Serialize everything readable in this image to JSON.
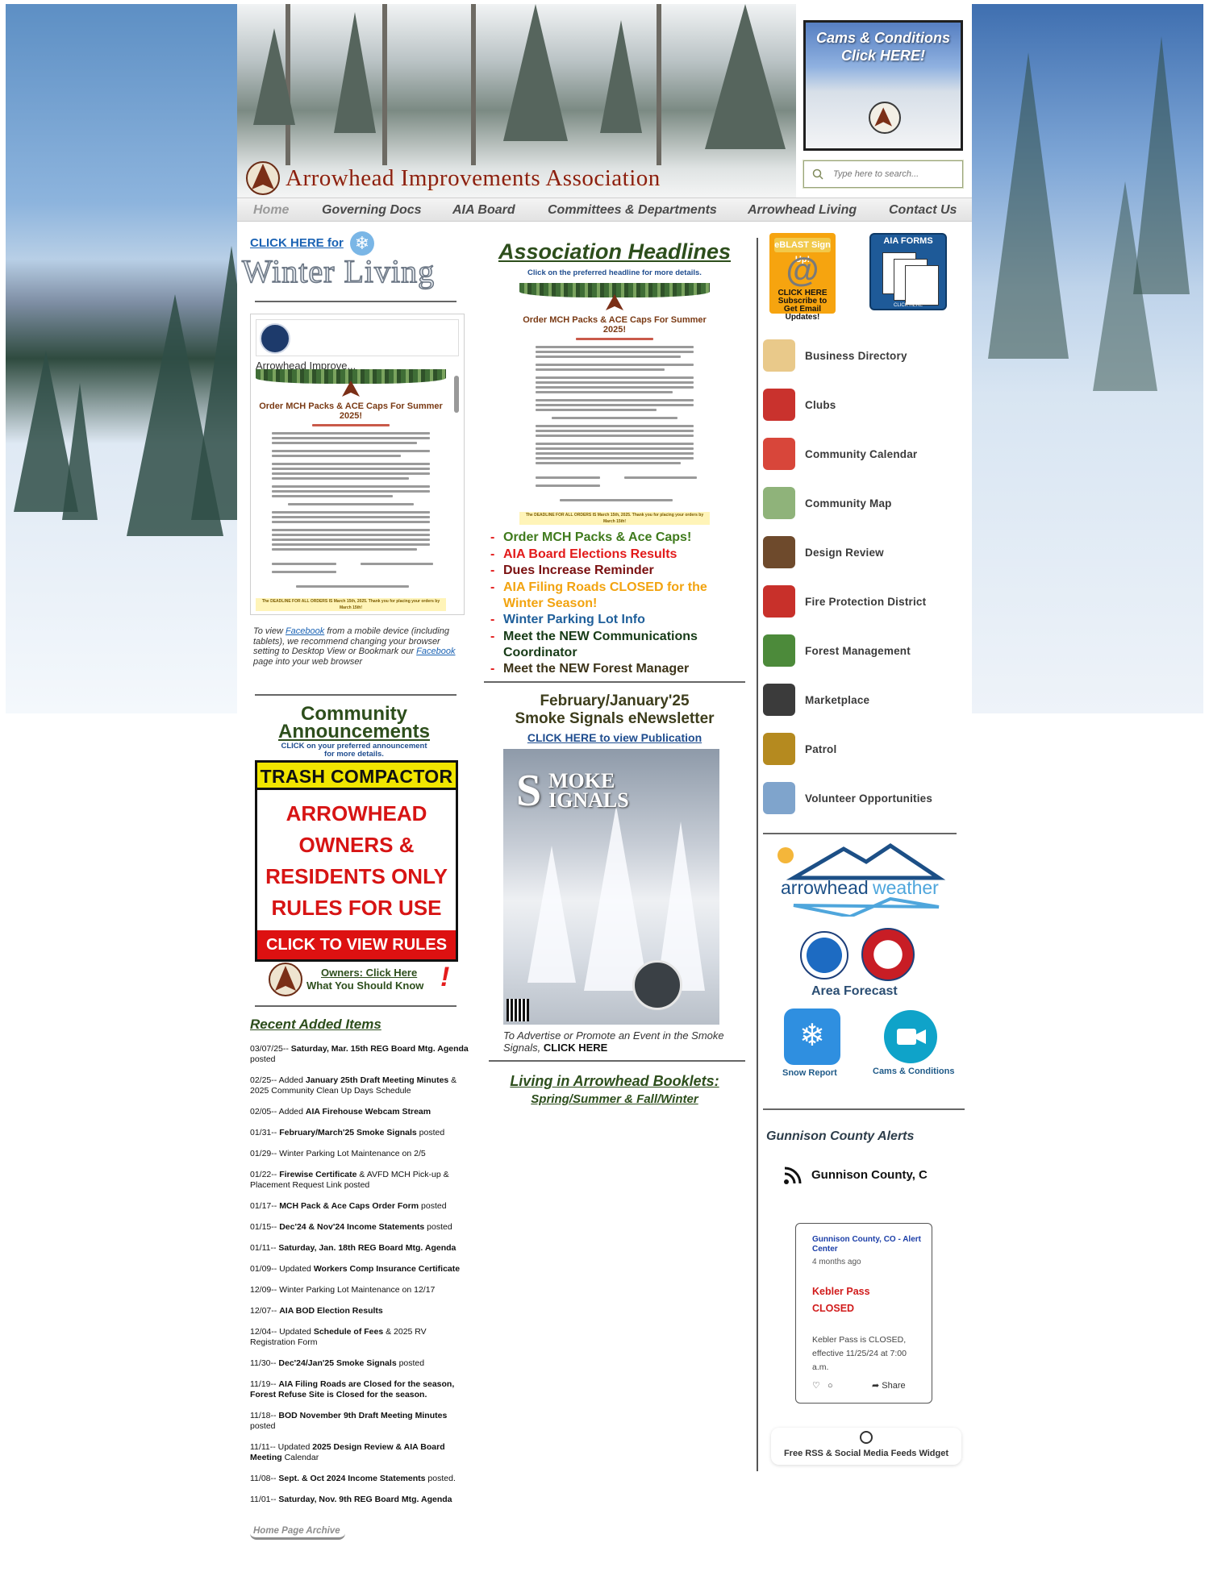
{
  "header": {
    "site_title": "Arrowhead Improvements Association",
    "cams_title": "Cams & Conditions Click HERE!",
    "search_placeholder": "Type here to search..."
  },
  "nav": {
    "items": [
      "Home",
      "Governing Docs",
      "AIA Board",
      "Committees & Departments",
      "Arrowhead Living",
      "Contact Us"
    ]
  },
  "left": {
    "click_here_for": "CLICK HERE for",
    "winter_living": "Winter Living",
    "fb_page_name": "Arrowhead Improve...",
    "flyer_title": "Order MCH Packs & ACE Caps For Summer 2025!",
    "flyer_footer": "The DEADLINE FOR ALL ORDERS IS March 15th, 2025. Thank you for placing your orders by March 15th!",
    "fb_note_1": "To view ",
    "fb_note_link_1": "Facebook",
    "fb_note_2": " from a mobile device (including tablets), we recommend changing your browser setting to Desktop View or Bookmark our ",
    "fb_note_link_2": "Facebook",
    "fb_note_3": " page into your web browser",
    "community_title_1": "Community",
    "community_title_2": "Announcements",
    "community_sub_1": "CLICK on your preferred announcement",
    "community_sub_2": "for more details.",
    "trash_top": "TRASH COMPACTOR",
    "trash_lines": [
      "ARROWHEAD",
      "OWNERS &",
      "RESIDENTS ONLY",
      "RULES FOR USE"
    ],
    "trash_bottom": "CLICK TO VIEW RULES",
    "owners_link": "Owners: Click Here",
    "owners_sub": "What You Should Know",
    "recent_title": "Recent Added Items",
    "recent_items": [
      {
        "pre": "03/07/25-- ",
        "bold": "Saturday, Mar. 15th REG Board Mtg. Agenda",
        "post": " posted"
      },
      {
        "pre": "02/25--  Added ",
        "bold": "January 25th Draft Meeting Minutes",
        "post": " & 2025 Community Clean Up Days Schedule"
      },
      {
        "pre": "02/05-- Added ",
        "bold": "AIA Firehouse Webcam Stream",
        "post": ""
      },
      {
        "pre": "01/31-- ",
        "bold": "February/March'25 Smoke Signals",
        "post": " posted"
      },
      {
        "pre": "01/29-- Winter Parking Lot Maintenance on 2/5",
        "bold": "",
        "post": ""
      },
      {
        "pre": "01/22-- ",
        "bold": "Firewise Certificate",
        "post": " & AVFD MCH Pick-up & Placement Request Link posted"
      },
      {
        "pre": "01/17-- ",
        "bold": "MCH Pack & Ace Caps Order Form",
        "post": " posted"
      },
      {
        "pre": "01/15-- ",
        "bold": "Dec'24 & Nov'24 Income Statements",
        "post": " posted"
      },
      {
        "pre": "01/11-- ",
        "bold": "Saturday, Jan. 18th REG Board Mtg. Agenda",
        "post": ""
      },
      {
        "pre": "01/09-- Updated ",
        "bold": "Workers Comp Insurance Certificate",
        "post": ""
      },
      {
        "pre": "12/09--  Winter Parking Lot Maintenance on 12/17",
        "bold": "",
        "post": ""
      },
      {
        "pre": "12/07-- ",
        "bold": "AIA BOD Election Results",
        "post": ""
      },
      {
        "pre": "12/04-- Updated ",
        "bold": "Schedule of Fees",
        "post": " & 2025 RV Registration Form"
      },
      {
        "pre": "11/30--  ",
        "bold": "Dec'24/Jan'25 Smoke Signals",
        "post": " posted"
      },
      {
        "pre": "11/19-- ",
        "bold": "AIA Filing Roads are Closed for the season, Forest Refuse Site is Closed for the season.",
        "post": ""
      },
      {
        "pre": "11/18-- ",
        "bold": "BOD November 9th Draft Meeting Minutes",
        "post": " posted"
      },
      {
        "pre": "11/11-- Updated ",
        "bold": "2025 Design Review & AIA Board Meeting",
        "post": " Calendar"
      },
      {
        "pre": "11/08-- ",
        "bold": "Sept. & Oct 2024 Income Statements",
        "post": " posted."
      },
      {
        "pre": "11/01--  ",
        "bold": "Saturday, Nov. 9th REG Board Mtg. Agenda",
        "post": ""
      }
    ],
    "archive_button": "Home Page Archive"
  },
  "middle": {
    "headlines_title": "Association Headlines",
    "headlines_sub": "Click on the preferred headline for more details.",
    "flyer_title": "Order MCH Packs & ACE Caps For Summer 2025!",
    "flyer_footer": "The DEADLINE FOR ALL ORDERS IS March 15th, 2025. Thank you for placing your orders by March 15th!",
    "headlines": [
      {
        "text": "Order MCH Packs & Ace Caps!",
        "color": "#3f7a1c"
      },
      {
        "text": "AIA Board Elections Results",
        "color": "#e21a1a"
      },
      {
        "text": "Dues Increase Reminder",
        "color": "#7a1010"
      },
      {
        "text": "AIA Filing Roads CLOSED for the Winter Season!",
        "color": "#f2a30f"
      },
      {
        "text": "Winter Parking Lot Info",
        "color": "#1f5f9a"
      },
      {
        "text": "Meet the NEW Communications Coordinator",
        "color": "#173b17"
      },
      {
        "text": "Meet the NEW Forest Manager",
        "color": "#3d3419"
      }
    ],
    "smoke_title_1": "February/January'25",
    "smoke_title_2": "Smoke Signals eNewsletter",
    "smoke_link": "CLICK HERE to view Publication",
    "smoke_logo_s": "S",
    "smoke_logo_rest": "MOKE IGNALS",
    "advert_text": "To Advertise or Promote an Event in the Smoke Signals, ",
    "advert_bold": "CLICK HERE",
    "booklets_title": "Living in Arrowhead Booklets:",
    "booklets_sub": "Spring/Summer & Fall/Winter"
  },
  "right": {
    "eblast_tag": "eBLAST Sign Up!",
    "eblast_lines": [
      "CLICK HERE",
      "Subscribe to",
      "Get Email Updates!"
    ],
    "forms_label": "AIA FORMS",
    "forms_click": "CLICK HERE",
    "directory": [
      {
        "label": "Business Directory",
        "color": "#e9c98a",
        "icon": "directory-icon"
      },
      {
        "label": "Clubs",
        "color": "#c9322d",
        "icon": "clubs-icon"
      },
      {
        "label": "Community Calendar",
        "color": "#d8463a",
        "icon": "calendar-icon"
      },
      {
        "label": "Community Map",
        "color": "#8fb37a",
        "icon": "map-icon"
      },
      {
        "label": "Design Review",
        "color": "#6e4a2c",
        "icon": "design-icon"
      },
      {
        "label": "Fire Protection District",
        "color": "#c8302a",
        "icon": "fire-icon"
      },
      {
        "label": "Forest Management",
        "color": "#4c8a3a",
        "icon": "forest-icon"
      },
      {
        "label": "Marketplace",
        "color": "#3b3b3b",
        "icon": "market-icon"
      },
      {
        "label": "Patrol",
        "color": "#b58a1f",
        "icon": "patrol-icon"
      },
      {
        "label": "Volunteer Opportunities",
        "color": "#7fa4cc",
        "icon": "volunteer-icon"
      }
    ],
    "weather_brand_1": "arrowhead",
    "weather_brand_2": "weather",
    "area_forecast": "Area Forecast",
    "snow_report": "Snow Report",
    "cams_conditions": "Cams & Conditions",
    "alerts_title": "Gunnison County Alerts",
    "rss_name": "Gunnison County, C",
    "alert_source": "Gunnison County, CO - Alert Center",
    "alert_ago": "4 months ago",
    "alert_head_1": "Kebler Pass",
    "alert_head_2": "CLOSED",
    "alert_body": "Kebler Pass is CLOSED, effective 11/25/24 at 7:00 a.m.",
    "share_label": "Share",
    "widget_footer": "Free RSS & Social Media Feeds Widget"
  }
}
